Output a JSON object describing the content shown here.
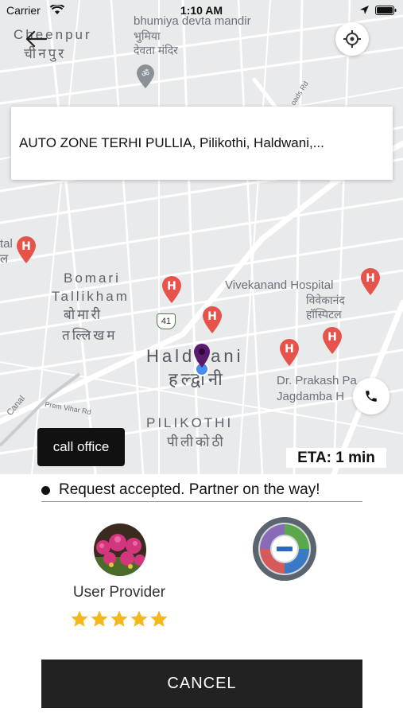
{
  "status_bar": {
    "carrier": "Carrier",
    "time": "1:10 AM"
  },
  "map": {
    "labels": {
      "cheenpur_en": "Cheenpur",
      "cheenpur_hi": "चीनपुर",
      "bhumiya_en": "bhumiya devta mandir",
      "bhumiya_hi1": "भुमिया",
      "bhumiya_hi2": "देवता मंदिर",
      "bomari_en1": "Bomari",
      "bomari_en2": "Tallikham",
      "bomari_hi1": "बोमारी",
      "bomari_hi2": "तल्लिखम",
      "vivekanand_en": "Vivekanand Hospital",
      "vivekanand_hi1": "विवेकानंद",
      "vivekanand_hi2": "हॉस्पिटल",
      "haldwani_en": "Haldwani",
      "haldwani_hi": "हल्द्वानी",
      "prakash_en1": "Dr. Prakash Pa",
      "prakash_en2": "Jagdamba H",
      "pilikothi_en": "PILIKOTHI",
      "pilikothi_hi": "पीलीकोठी",
      "prem_vihar": "Prem Vihar Rd",
      "canal": "Canal",
      "road_shield": "41",
      "left_cut_1": "tal",
      "left_cut_2": "ल",
      "road_label": "oads Rd"
    }
  },
  "address": {
    "text": "AUTO ZONE TERHI PULLIA, Pilikothi, Haldwani,..."
  },
  "call_office": {
    "label": "call office"
  },
  "eta": {
    "label": "ETA: 1 min"
  },
  "request": {
    "status": "Request accepted. Partner on the way!"
  },
  "provider": {
    "name": "User Provider",
    "rating": 5
  },
  "cancel": {
    "label": "CANCEL"
  },
  "colors": {
    "hospital_pin": "#e5534b",
    "destination_pin": "#5a1a6e",
    "rating_star": "#f5b81a",
    "button_dark": "#222222"
  },
  "icons": {
    "back": "back-arrow-icon",
    "locate": "crosshair-icon",
    "phone": "phone-icon",
    "hospital": "hospital-pin-icon",
    "destination": "map-pin-icon"
  }
}
